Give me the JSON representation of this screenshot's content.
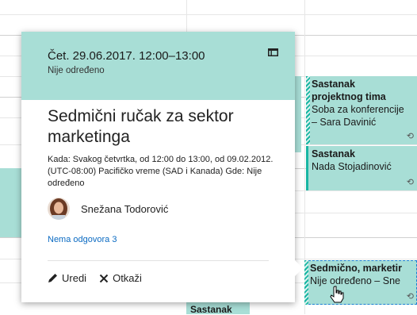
{
  "popup": {
    "date_time": "Čet. 29.06.2017. 12:00–13:00",
    "location": "Nije određeno",
    "subject": "Sedmični ručak za sektor marketinga",
    "details": "Kada: Svakog četvrtka, od 12:00 do 13:00, od 09.02.2012. (UTC-08:00) Pacifičko vreme (SAD i Kanada) Gde: Nije određeno",
    "organizer": "Snežana Todorović",
    "response_link": "Nema odgovora 3",
    "edit_label": "Uredi",
    "cancel_label": "Otkaži"
  },
  "calendar_events": [
    {
      "title": "Sastanak projektnog tima",
      "line1": "Sastanak",
      "line2": "projektnog tima",
      "line3": "Soba za konferencije",
      "line4": "– Sara Davinić"
    },
    {
      "title": "Sastanak",
      "line2": "Nada Stojadinović"
    },
    {
      "title": "Sedmično, marketir",
      "line2": "Nije određeno – Sne"
    },
    {
      "title": "Sastanak"
    }
  ],
  "colors": {
    "accent": "#18b6a3",
    "event_fill": "#a8ded6",
    "link": "#0a6ac2"
  }
}
